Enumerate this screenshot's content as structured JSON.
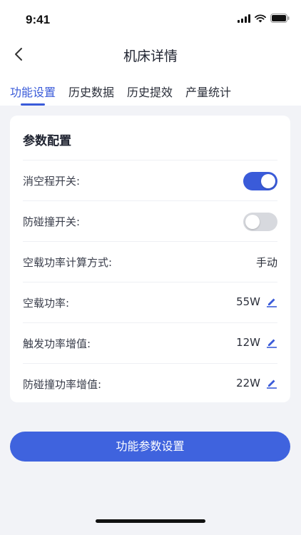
{
  "status_bar": {
    "time": "9:41"
  },
  "nav": {
    "title": "机床详情"
  },
  "tabs": [
    {
      "label": "功能设置",
      "active": true
    },
    {
      "label": "历史数据",
      "active": false
    },
    {
      "label": "历史提效",
      "active": false
    },
    {
      "label": "产量统计",
      "active": false
    }
  ],
  "card": {
    "title": "参数配置",
    "rows": [
      {
        "label": "消空程开关:",
        "type": "toggle",
        "on": true
      },
      {
        "label": "防碰撞开关:",
        "type": "toggle",
        "on": false
      },
      {
        "label": "空载功率计算方式:",
        "type": "text",
        "value": "手动"
      },
      {
        "label": "空载功率:",
        "type": "editable",
        "value": "55W"
      },
      {
        "label": "触发功率增值:",
        "type": "editable",
        "value": "12W"
      },
      {
        "label": "防碰撞功率增值:",
        "type": "editable",
        "value": "22W"
      }
    ]
  },
  "primary_button": {
    "label": "功能参数设置"
  },
  "colors": {
    "accent": "#3F63DE",
    "background": "#F2F3F7",
    "toggle_off": "#D7D9DE"
  }
}
